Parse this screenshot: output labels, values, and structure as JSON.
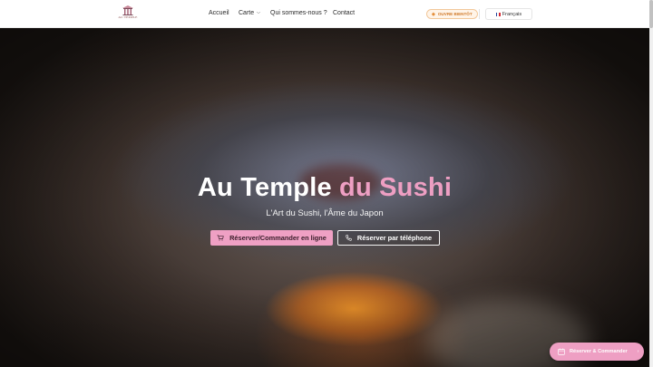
{
  "brand": {
    "logo_text": "AU TEMPLE"
  },
  "nav": {
    "items": [
      {
        "label": "Accueil"
      },
      {
        "label": "Carte",
        "has_dropdown": true
      },
      {
        "label": "Qui sommes-nous ?"
      },
      {
        "label": "Contact"
      }
    ]
  },
  "status": {
    "label": "OUVRE BIENTÔT",
    "color": "#e38a32"
  },
  "language": {
    "selected": "Français"
  },
  "hero": {
    "title_main": "Au Temple",
    "title_accent": "du Sushi",
    "subtitle": "L'Art du Sushi, l'Âme du Japon",
    "primary_button": "Réserver/Commander en ligne",
    "secondary_button": "Réserver par téléphone"
  },
  "fab": {
    "label": "Réserver & Commander"
  },
  "colors": {
    "accent": "#ee9fc3",
    "accent_button": "#efa0c4",
    "status_bg": "#fff4e8"
  }
}
